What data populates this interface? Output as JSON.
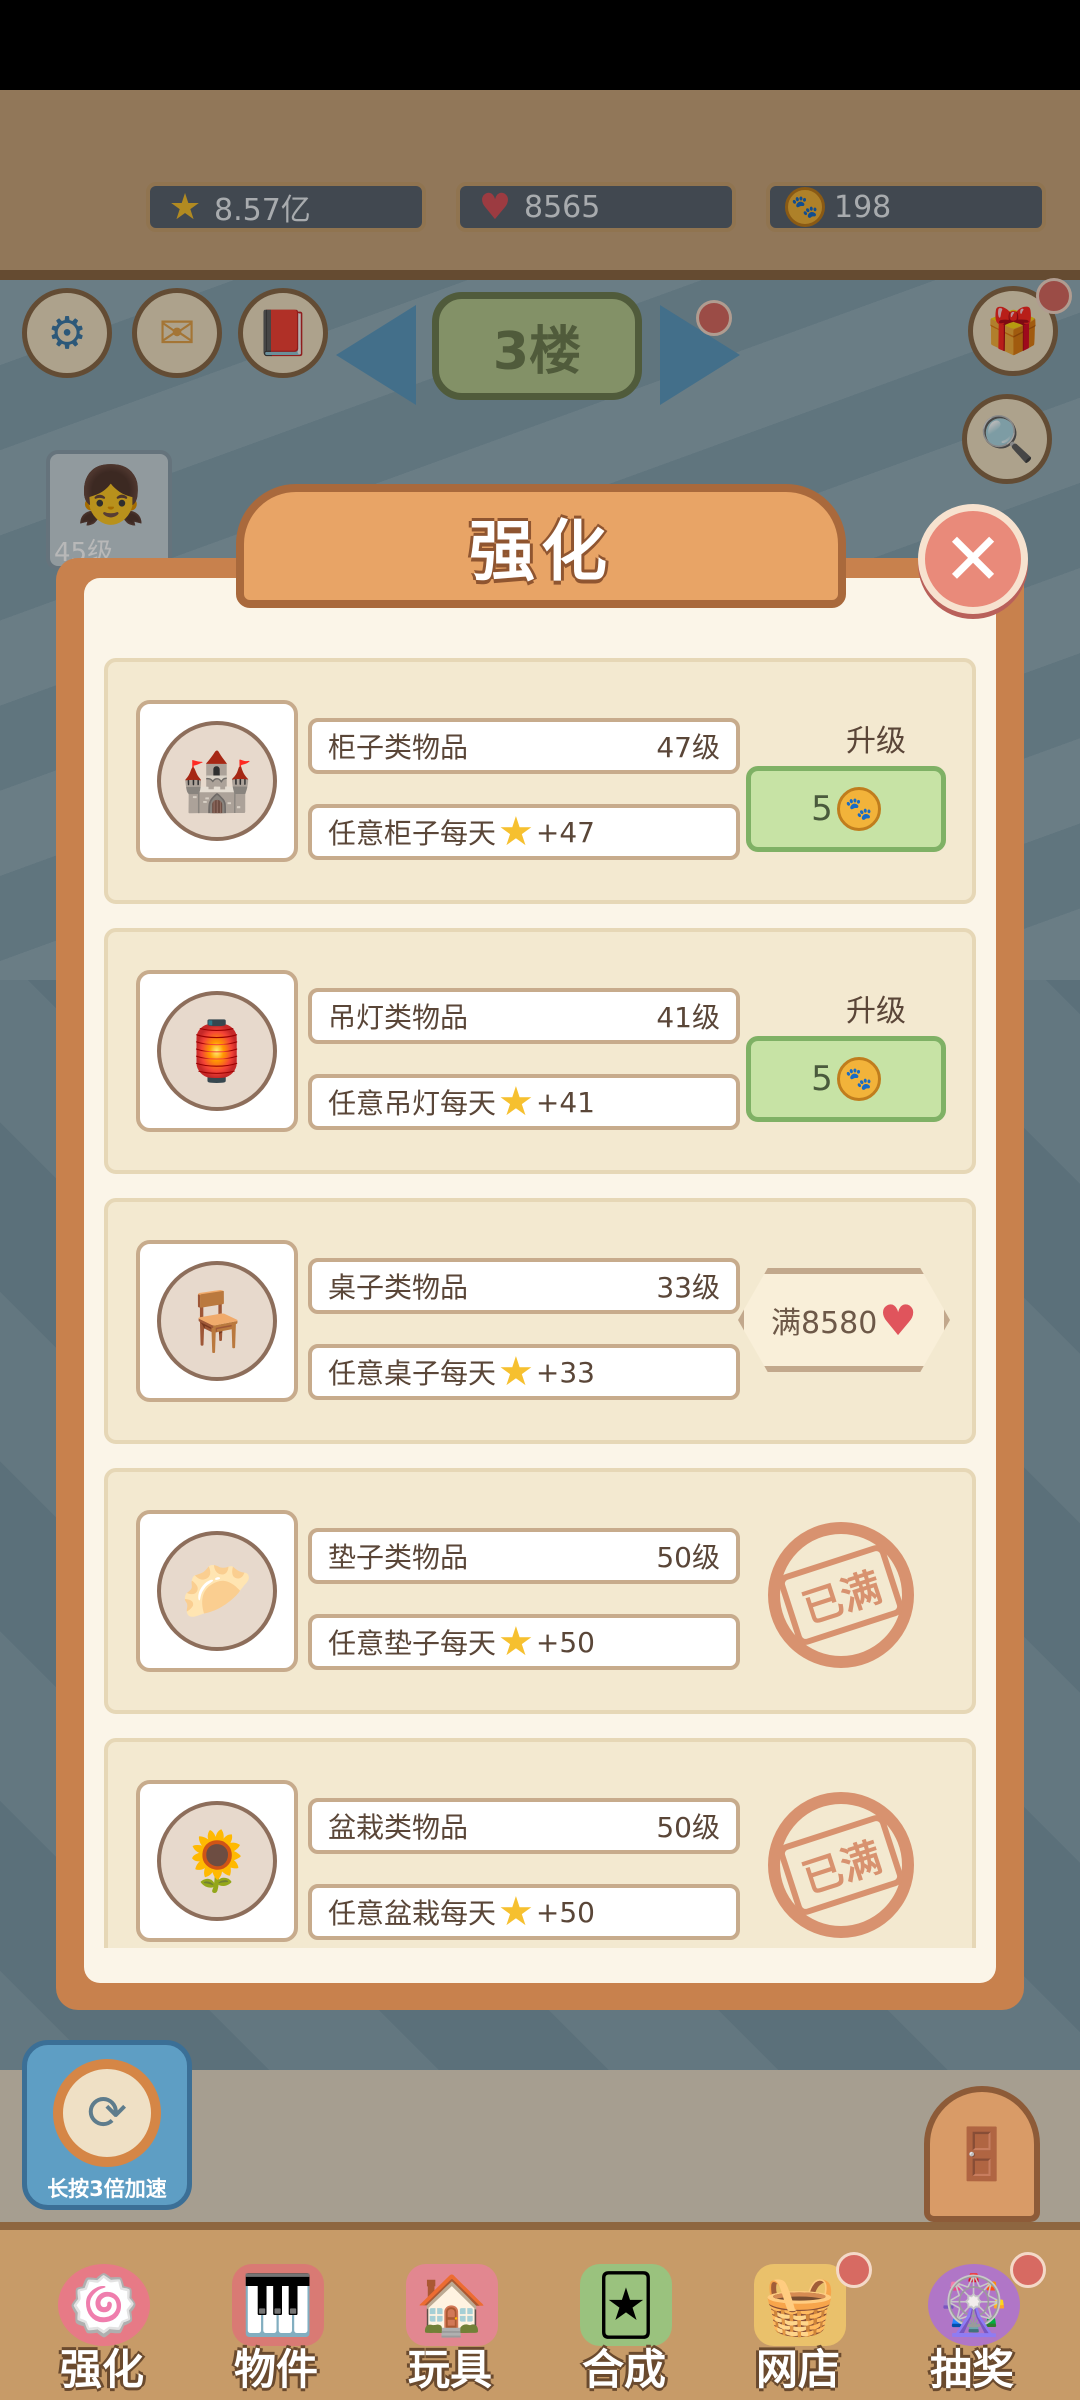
{
  "currencies": {
    "stars": "8.57亿",
    "hearts": "8565",
    "coins": "198"
  },
  "floor_sign": "3楼",
  "player_level": "45级",
  "panel": {
    "title": "强化",
    "close_symbol": "✕"
  },
  "items": [
    {
      "name": "柜子类物品",
      "level": "47级",
      "desc": "任意柜子每天",
      "bonus": "+47",
      "action_label": "升级",
      "cost": "5",
      "icon": "cabinet-icon",
      "pic": "🏰"
    },
    {
      "name": "吊灯类物品",
      "level": "41级",
      "desc": "任意吊灯每天",
      "bonus": "+41",
      "action_label": "升级",
      "cost": "5",
      "icon": "lamp-icon",
      "pic": "🏮"
    },
    {
      "name": "桌子类物品",
      "level": "33级",
      "desc": "任意桌子每天",
      "bonus": "+33",
      "full_cost": "满8580",
      "icon": "table-icon",
      "pic": "🪑"
    },
    {
      "name": "垫子类物品",
      "level": "50级",
      "desc": "任意垫子每天",
      "bonus": "+50",
      "stamp": "已满",
      "icon": "cushion-icon",
      "pic": "🥟"
    },
    {
      "name": "盆栽类物品",
      "level": "50级",
      "desc": "任意盆栽每天",
      "bonus": "+50",
      "stamp": "已满",
      "icon": "plant-icon",
      "pic": "🌻"
    }
  ],
  "speed_button": "长按3倍加速",
  "tabs": [
    "强化",
    "物件",
    "玩具",
    "合成",
    "网店",
    "抽奖"
  ],
  "colors": {
    "panel_frame": "#c8814d",
    "upgrade_green": "#c7e3a5",
    "stamp": "#d8926f"
  }
}
